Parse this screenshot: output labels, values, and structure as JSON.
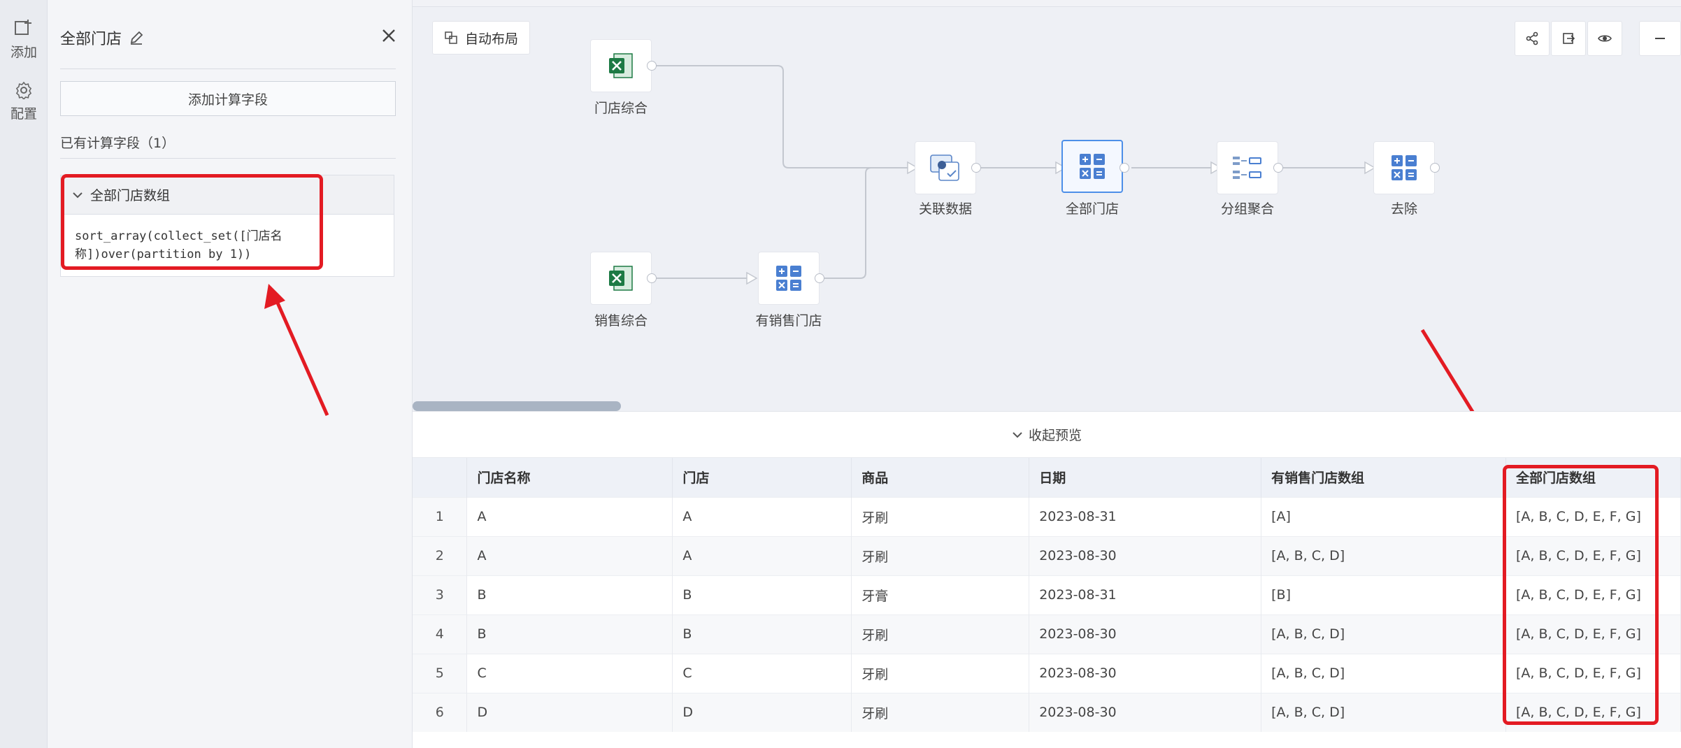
{
  "rail": {
    "add_label": "添加",
    "config_label": "配置"
  },
  "panel": {
    "title": "全部门店",
    "add_field_button": "添加计算字段",
    "existing_label": "已有计算字段（1）",
    "field": {
      "name": "全部门店数组",
      "expression": "sort_array(collect_set([门店名\n称])over(partition by 1))"
    }
  },
  "canvas": {
    "auto_layout": "自动布局",
    "nodes": {
      "store_summary": "门店综合",
      "sales_summary": "销售综合",
      "stores_with_sales": "有销售门店",
      "join_data": "关联数据",
      "all_stores": "全部门店",
      "group_aggregate": "分组聚合",
      "dedupe": "去除"
    }
  },
  "preview": {
    "collapse_label": "收起预览",
    "columns": [
      "",
      "门店名称",
      "门店",
      "商品",
      "日期",
      "有销售门店数组",
      "全部门店数组"
    ],
    "rows": [
      [
        "1",
        "A",
        "A",
        "牙刷",
        "2023-08-31",
        "[A]",
        "[A, B, C, D, E, F, G]"
      ],
      [
        "2",
        "A",
        "A",
        "牙刷",
        "2023-08-30",
        "[A, B, C, D]",
        "[A, B, C, D, E, F, G]"
      ],
      [
        "3",
        "B",
        "B",
        "牙膏",
        "2023-08-31",
        "[B]",
        "[A, B, C, D, E, F, G]"
      ],
      [
        "4",
        "B",
        "B",
        "牙刷",
        "2023-08-30",
        "[A, B, C, D]",
        "[A, B, C, D, E, F, G]"
      ],
      [
        "5",
        "C",
        "C",
        "牙刷",
        "2023-08-30",
        "[A, B, C, D]",
        "[A, B, C, D, E, F, G]"
      ],
      [
        "6",
        "D",
        "D",
        "牙刷",
        "2023-08-30",
        "[A, B, C, D]",
        "[A, B, C, D, E, F, G]"
      ]
    ]
  },
  "colors": {
    "annotation_red": "#e31b23",
    "excel_green": "#1d7a44",
    "calc_blue": "#4a7fd1",
    "selected_border": "#4d8fe8"
  }
}
